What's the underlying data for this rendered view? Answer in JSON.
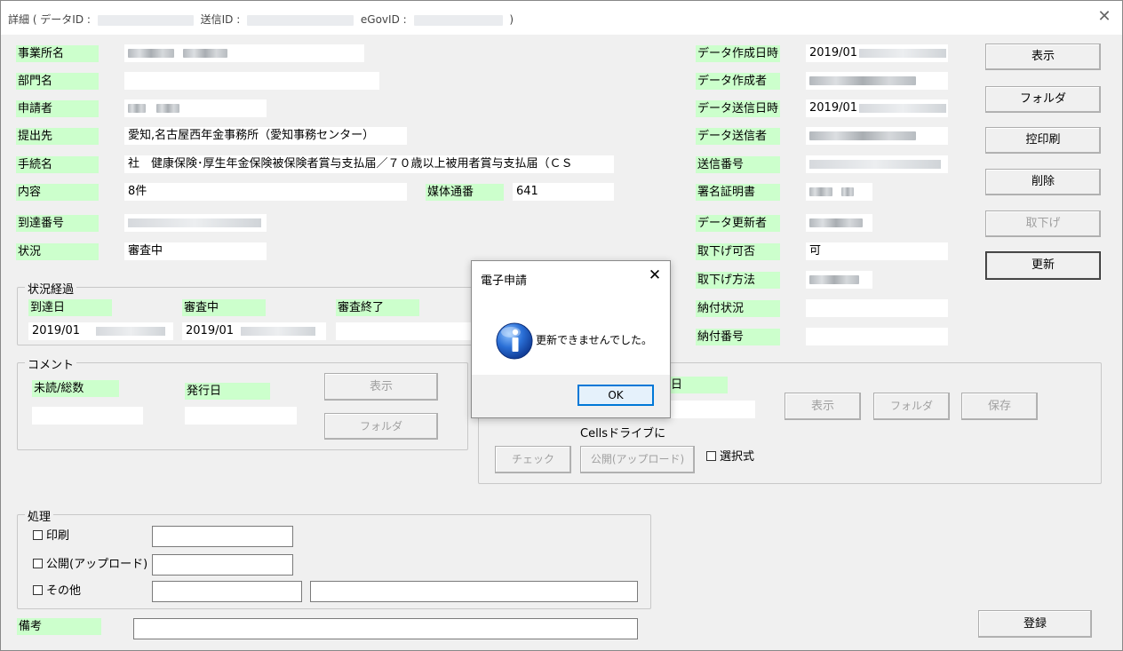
{
  "window": {
    "title_prefix": "詳細 ( データID :",
    "title_send_id": "送信ID :",
    "title_egov_id": "eGovID :",
    "title_suffix": ")",
    "close_glyph": "✕"
  },
  "left_fields": {
    "office_label": "事業所名",
    "department_label": "部門名",
    "applicant_label": "申請者",
    "submit_to_label": "提出先",
    "submit_to_value": "愛知,名古屋西年金事務所（愛知事務センター）",
    "procedure_label": "手続名",
    "procedure_value": "社　健康保険･厚生年金保険被保険者賞与支払届／７０歳以上被用者賞与支払届（ＣＳ",
    "content_label": "内容",
    "content_value": "8件",
    "media_label": "媒体通番",
    "media_value": "641",
    "arrival_label": "到達番号",
    "status_label": "状況",
    "status_value": "審査中"
  },
  "right_fields": {
    "created_at_label": "データ作成日時",
    "created_at_value": "2019/01",
    "creator_label": "データ作成者",
    "sent_at_label": "データ送信日時",
    "sent_at_value": "2019/01",
    "sender_label": "データ送信者",
    "send_number_label": "送信番号",
    "certificate_label": "署名証明書",
    "updater_label": "データ更新者",
    "withdraw_allowed_label": "取下げ可否",
    "withdraw_allowed_value": "可",
    "withdraw_method_label": "取下げ方法",
    "payment_status_label": "納付状況",
    "payment_number_label": "納付番号"
  },
  "right_buttons": {
    "show": "表示",
    "folder": "フォルダ",
    "copy_print": "控印刷",
    "delete": "削除",
    "withdraw": "取下げ",
    "update": "更新"
  },
  "progress": {
    "title": "状況経過",
    "arrival_date_label": "到達日",
    "arrival_date_value": "2019/01",
    "reviewing_label": "審査中",
    "reviewing_value": "2019/01",
    "review_done_label": "審査終了"
  },
  "comment": {
    "title": "コメント",
    "unread_label": "未読/総数",
    "issue_date_label": "発行日",
    "show_button": "表示",
    "folder_button": "フォルダ"
  },
  "official_doc": {
    "date_label_fragment": "日",
    "show_button": "表示",
    "folder_button": "フォルダ",
    "save_button": "保存",
    "cells_drive_text": "Cellsドライブに",
    "check_button": "チェック",
    "publish_button": "公開(アップロード)",
    "select_checkbox": "選択式"
  },
  "processing": {
    "title": "処理",
    "print_checkbox": "印刷",
    "publish_checkbox": "公開(アップロード)",
    "other_checkbox": "その他"
  },
  "notes": {
    "label": "備考",
    "register_button": "登録"
  },
  "dialog": {
    "title": "電子申請",
    "message": "更新できませんでした。",
    "ok_button": "OK",
    "close_glyph": "✕",
    "icon": "info-icon"
  },
  "colors": {
    "label_bg": "#ccffcc",
    "dialog_ok_border": "#0078d7",
    "info_icon_blue": "#1f5fbf"
  }
}
